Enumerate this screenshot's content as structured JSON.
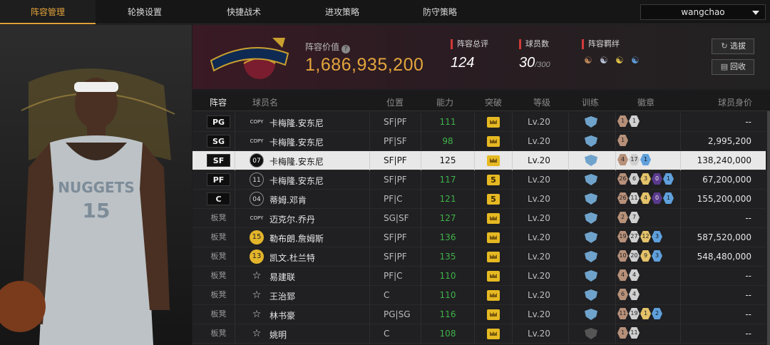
{
  "nav": {
    "tabs": [
      "阵容管理",
      "轮换设置",
      "快捷战术",
      "进攻策略",
      "防守策略"
    ],
    "active_index": 0,
    "user": "wangchao"
  },
  "header": {
    "value_label": "阵容价值",
    "value": "1,686,935,200",
    "rating_label": "阵容总评",
    "rating": "124",
    "count_label": "球员数",
    "count": "30",
    "count_max": "/300",
    "bond_label": "阵容羁绊",
    "btn_select": "选拔",
    "btn_recycle": "回收"
  },
  "table": {
    "headers": [
      "阵容",
      "球员名",
      "位置",
      "能力",
      "突破",
      "等级",
      "训练",
      "徽章",
      "球员身价"
    ],
    "rows": [
      {
        "role": "PG",
        "starter": true,
        "jersey": "COPY",
        "name": "卡梅隆.安东尼",
        "pos": "SF|PF",
        "ability": "111",
        "break": "crown",
        "level": "Lv.20",
        "badges": [
          [
            "b-bronze",
            "1"
          ],
          [
            "b-silver",
            "1"
          ]
        ],
        "value": "--"
      },
      {
        "role": "SG",
        "starter": true,
        "jersey": "COPY",
        "name": "卡梅隆.安东尼",
        "pos": "PF|SF",
        "ability": "98",
        "break": "crown",
        "level": "Lv.20",
        "badges": [
          [
            "b-bronze",
            "1"
          ]
        ],
        "value": "2,995,200"
      },
      {
        "role": "SF",
        "starter": true,
        "jersey": "07",
        "name": "卡梅隆.安东尼",
        "pos": "SF|PF",
        "ability": "125",
        "break": "crown",
        "level": "Lv.20",
        "badges": [
          [
            "b-bronze",
            "4"
          ],
          [
            "b-silver",
            "17"
          ],
          [
            "b-blue",
            "1"
          ]
        ],
        "value": "138,240,000",
        "selected": true
      },
      {
        "role": "PF",
        "starter": true,
        "jersey": "11",
        "name": "卡梅隆.安东尼",
        "pos": "SF|PF",
        "ability": "117",
        "break": "5",
        "level": "Lv.20",
        "badges": [
          [
            "b-bronze",
            "26"
          ],
          [
            "b-silver",
            "6"
          ],
          [
            "b-gold",
            "3"
          ],
          [
            "b-purple",
            "0"
          ],
          [
            "b-blue",
            "1"
          ]
        ],
        "value": "67,200,000"
      },
      {
        "role": "C",
        "starter": true,
        "jersey": "04",
        "name": "蒂姆.邓肯",
        "pos": "PF|C",
        "ability": "121",
        "break": "5",
        "level": "Lv.20",
        "badges": [
          [
            "b-bronze",
            "26"
          ],
          [
            "b-silver",
            "11"
          ],
          [
            "b-gold",
            "4"
          ],
          [
            "b-purple",
            "0"
          ],
          [
            "b-blue",
            "1"
          ]
        ],
        "value": "155,200,000"
      },
      {
        "role": "板凳",
        "starter": false,
        "jersey": "COPY",
        "name": "迈克尔.乔丹",
        "pos": "SG|SF",
        "ability": "127",
        "break": "crown",
        "level": "Lv.20",
        "badges": [
          [
            "b-bronze",
            "2"
          ],
          [
            "b-silver",
            "7"
          ]
        ],
        "value": "--"
      },
      {
        "role": "板凳",
        "starter": false,
        "jersey": "15",
        "name": "勒布朗.詹姆斯",
        "pos": "SF|PF",
        "ability": "136",
        "break": "crown",
        "level": "Lv.20",
        "badges": [
          [
            "b-bronze",
            "19"
          ],
          [
            "b-silver",
            "27"
          ],
          [
            "b-gold",
            "12"
          ],
          [
            "b-blue",
            "3"
          ]
        ],
        "value": "587,520,000"
      },
      {
        "role": "板凳",
        "starter": false,
        "jersey": "13",
        "name": "凯文.杜兰特",
        "pos": "SF|PF",
        "ability": "135",
        "break": "crown",
        "level": "Lv.20",
        "badges": [
          [
            "b-bronze",
            "10"
          ],
          [
            "b-silver",
            "20"
          ],
          [
            "b-gold",
            "9"
          ],
          [
            "b-blue",
            "3"
          ]
        ],
        "value": "548,480,000"
      },
      {
        "role": "板凳",
        "starter": false,
        "jersey": "star",
        "name": "易建联",
        "pos": "PF|C",
        "ability": "110",
        "break": "crown",
        "level": "Lv.20",
        "badges": [
          [
            "b-bronze",
            "4"
          ],
          [
            "b-silver",
            "4"
          ]
        ],
        "value": "--"
      },
      {
        "role": "板凳",
        "starter": false,
        "jersey": "star",
        "name": "王治郅",
        "pos": "C",
        "ability": "110",
        "break": "crown",
        "level": "Lv.20",
        "badges": [
          [
            "b-bronze",
            "6"
          ],
          [
            "b-silver",
            "4"
          ]
        ],
        "value": "--"
      },
      {
        "role": "板凳",
        "starter": false,
        "jersey": "star",
        "name": "林书豪",
        "pos": "PG|SG",
        "ability": "116",
        "break": "crown",
        "level": "Lv.20",
        "badges": [
          [
            "b-bronze",
            "11"
          ],
          [
            "b-silver",
            "19"
          ],
          [
            "b-gold",
            "1"
          ],
          [
            "b-blue",
            "2"
          ]
        ],
        "value": "--"
      },
      {
        "role": "板凳",
        "starter": false,
        "jersey": "star",
        "name": "姚明",
        "pos": "C",
        "ability": "108",
        "break": "crown",
        "level": "Lv.20",
        "badges": [
          [
            "b-bronze",
            "1"
          ],
          [
            "b-silver",
            "11"
          ]
        ],
        "value": "--",
        "train_dim": true
      }
    ]
  },
  "colors": {
    "accent": "#e1a23a",
    "ability_green": "#3fb24a",
    "stat_marker": "#d13a3a"
  }
}
